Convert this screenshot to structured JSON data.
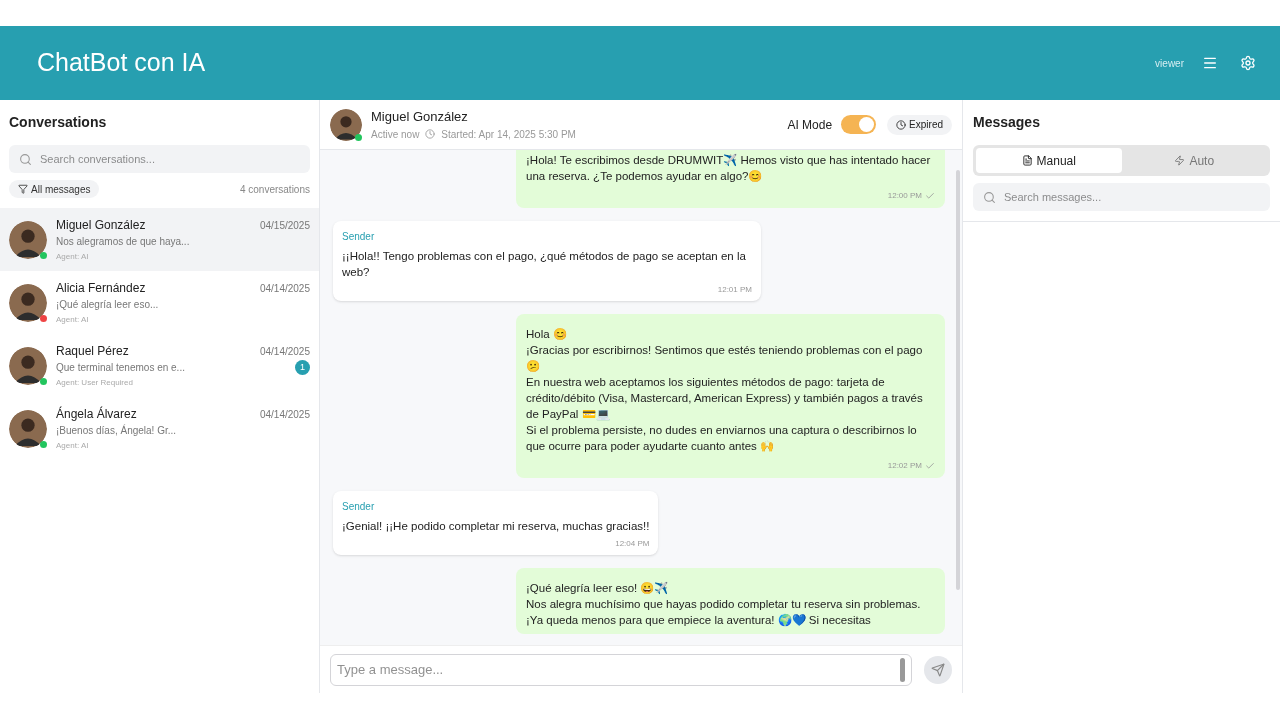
{
  "header": {
    "title": "ChatBot con IA",
    "role": "viewer"
  },
  "sidebar": {
    "title": "Conversations",
    "search_placeholder": "Search conversations...",
    "filter": "All messages",
    "count": "4 conversations",
    "conversations": [
      {
        "name": "Miguel González",
        "date": "04/15/2025",
        "preview": "Nos alegramos de que haya...",
        "agent": "Agent: AI",
        "selected": true,
        "color": "#22c55e"
      },
      {
        "name": "Alicia Fernández",
        "date": "04/14/2025",
        "preview": "¡Qué alegría leer eso...",
        "agent": "Agent: AI",
        "selected": false,
        "color": "#ef4444"
      },
      {
        "name": "Raquel Pérez",
        "date": "04/14/2025",
        "preview": "Que terminal tenemos en e...",
        "agent": "Agent: User Required",
        "selected": false,
        "color": "#22c55e",
        "unread": "1"
      },
      {
        "name": "Ángela Álvarez",
        "date": "04/14/2025",
        "preview": "¡Buenos días, Ángela! Gr...",
        "agent": "Agent: AI",
        "selected": false,
        "color": "#22c55e"
      }
    ]
  },
  "chat": {
    "name": "Miguel González",
    "presence": "Active now",
    "started": "Started: Apr 14, 2025 5:30 PM",
    "ai_mode_label": "AI Mode",
    "ai_mode": true,
    "status": "Expired",
    "messages": [
      {
        "kind": "outgoing",
        "text": "¡Hola! Te escribimos desde DRUMWIT✈️ Hemos visto que has intentado hacer una reserva. ¿Te podemos ayudar en algo?😊",
        "time": "12:00 PM",
        "read": true
      },
      {
        "kind": "incoming",
        "sender": "Sender",
        "text": "¡¡Hola!! Tengo problemas con el pago, ¿qué métodos de pago se aceptan en la web?",
        "time": "12:01 PM"
      },
      {
        "kind": "outgoing",
        "text": "Hola 😊\n¡Gracias por escribirnos! Sentimos que estés teniendo problemas con el pago 😕\nEn nuestra web aceptamos los siguientes métodos de pago: tarjeta de crédito/débito (Visa, Mastercard, American Express) y también pagos a través de PayPal 💳💻\nSi el problema persiste, no dudes en enviarnos una captura o describirnos lo que ocurre para poder ayudarte cuanto antes 🙌",
        "time": "12:02 PM",
        "read": true
      },
      {
        "kind": "incoming",
        "sender": "Sender",
        "text": "¡Genial! ¡¡He podido completar mi reserva, muchas gracias!!",
        "time": "12:04 PM"
      },
      {
        "kind": "outgoing",
        "text": "¡Qué alegría leer eso! 😀✈️\nNos alegra muchísimo que hayas podido completar tu reserva sin problemas.\n¡Ya queda menos para que empiece la aventura! 🌍💙 Si necesitas"
      }
    ],
    "input_placeholder": "Type a message..."
  },
  "panel": {
    "title": "Messages",
    "tabs": [
      {
        "label": "Manual",
        "selected": true
      },
      {
        "label": "Auto",
        "selected": false
      }
    ],
    "search_placeholder": "Search messages..."
  }
}
